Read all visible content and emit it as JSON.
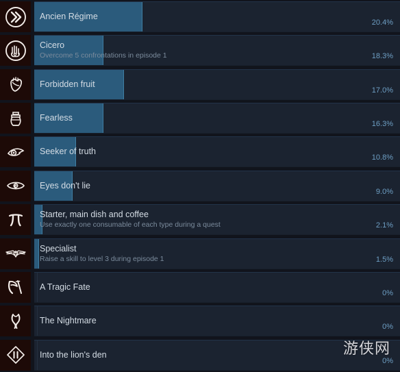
{
  "page": {
    "title": "Steam Global Achievements",
    "background_color": "#11141c",
    "row_background_color": "#1b2330",
    "bar_color": "#2b5b7c",
    "percent_color": "#6e9fc4",
    "name_color": "#d4dce4",
    "desc_color": "#7b8b9c",
    "icon_tile_color": "#1d0a07"
  },
  "watermark": {
    "text": "游侠网"
  },
  "achievements": [
    {
      "name": "Ancien Régime",
      "description": "",
      "percent_label": "20.4%",
      "percent_value": 20.4,
      "bar_width_pct": 29.5,
      "icon": "double-chevron-icon"
    },
    {
      "name": "Cicero",
      "description": "Overcome 5 confrontations in episode 1",
      "percent_label": "18.3%",
      "percent_value": 18.3,
      "bar_width_pct": 19.0,
      "icon": "raised-hand-icon"
    },
    {
      "name": "Forbidden fruit",
      "description": "",
      "percent_label": "17.0%",
      "percent_value": 17.0,
      "bar_width_pct": 24.5,
      "icon": "heart-fruit-icon"
    },
    {
      "name": "Fearless",
      "description": "",
      "percent_label": "16.3%",
      "percent_value": 16.3,
      "bar_width_pct": 19.0,
      "icon": "urn-icon"
    },
    {
      "name": "Seeker of truth",
      "description": "",
      "percent_label": "10.8%",
      "percent_value": 10.8,
      "bar_width_pct": 11.5,
      "icon": "eye-icon"
    },
    {
      "name": "Eyes don't lie",
      "description": "",
      "percent_label": "9.0%",
      "percent_value": 9.0,
      "bar_width_pct": 10.5,
      "icon": "spiral-eye-icon"
    },
    {
      "name": "Starter, main dish and coffee",
      "description": "Use exactly one consumable of each type during a quest",
      "percent_label": "2.1%",
      "percent_value": 2.1,
      "bar_width_pct": 2.2,
      "icon": "pi-symbol-icon"
    },
    {
      "name": "Specialist",
      "description": "Raise a skill to level 3 during episode 1",
      "percent_label": "1.5%",
      "percent_value": 1.5,
      "bar_width_pct": 1.3,
      "icon": "winged-badge-icon"
    },
    {
      "name": "A Tragic Fate",
      "description": "",
      "percent_label": "0%",
      "percent_value": 0,
      "bar_width_pct": 0,
      "icon": "scythe-icon"
    },
    {
      "name": "The Nightmare",
      "description": "",
      "percent_label": "0%",
      "percent_value": 0,
      "bar_width_pct": 0,
      "icon": "twisted-flame-icon"
    },
    {
      "name": "Into the lion's den",
      "description": "",
      "percent_label": "0%",
      "percent_value": 0,
      "bar_width_pct": 0,
      "icon": "diamond-pillars-icon"
    }
  ]
}
